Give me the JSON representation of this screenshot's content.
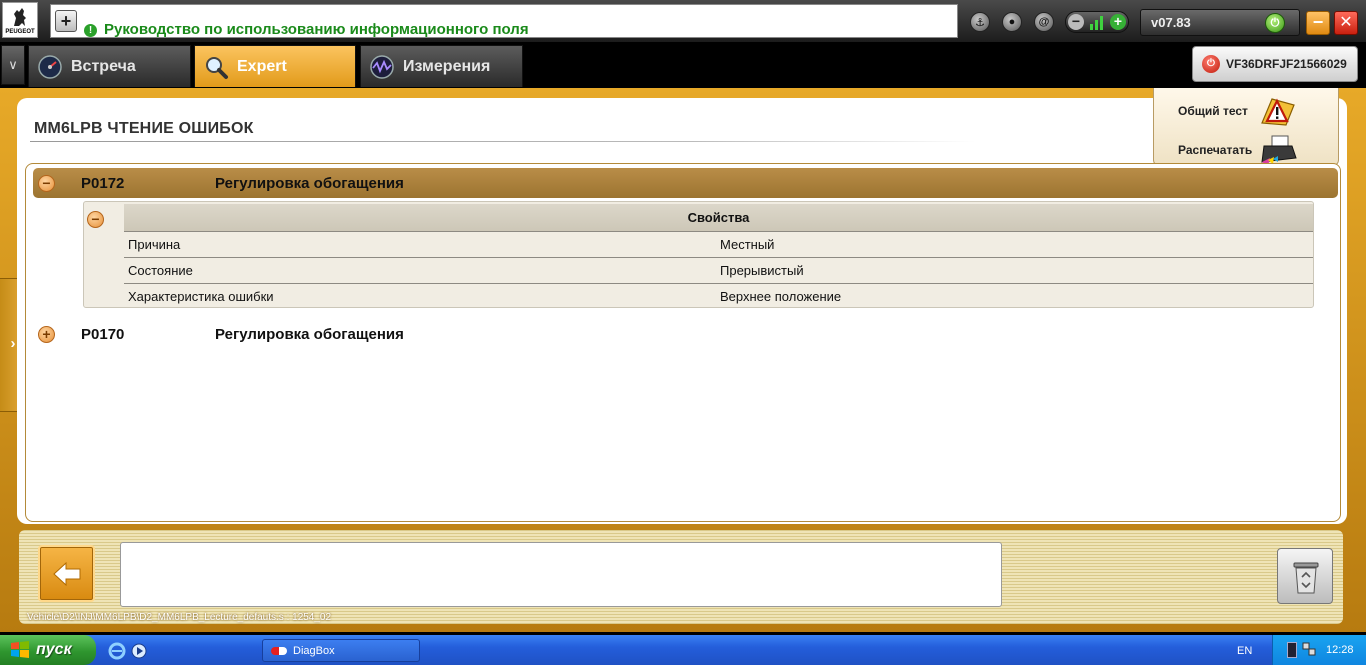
{
  "app": {
    "logo_text": "PEUGEOT",
    "info_text": "Руководство по использованию информационного поля",
    "version": "v07.83",
    "vin": "VF36DRFJF21566029"
  },
  "tabs": [
    {
      "label": "Встреча",
      "active": false
    },
    {
      "label": "Expert",
      "active": true
    },
    {
      "label": "Измерения",
      "active": false
    }
  ],
  "panel": {
    "title": "MM6LPB  ЧТЕНИЕ ОШИБОК",
    "actions": {
      "general_test": "Общий тест",
      "print": "Распечатать"
    }
  },
  "faults": [
    {
      "code": "P0172",
      "description": "Регулировка обогащения",
      "expanded": true,
      "properties_header": "Свойства",
      "properties": [
        {
          "key": "Причина",
          "value": "Местный"
        },
        {
          "key": "Состояние",
          "value": "Прерывистый"
        },
        {
          "key": "Характеристика ошибки",
          "value": "Верхнее положение"
        }
      ]
    },
    {
      "code": "P0170",
      "description": "Регулировка обогащения",
      "expanded": false
    }
  ],
  "status": {
    "path": "Vehicle\\D2\\INJ\\MM6LPB\\D2_MM6LPB_Lecture_defauts.s : 1254_02",
    "message": ""
  },
  "taskbar": {
    "start_label": "пуск",
    "task": "DiagBox",
    "language": "EN",
    "clock": "12:28"
  },
  "colors": {
    "accent_gold": "#e2a326",
    "fault_row": "#a8803a",
    "info_green": "#1a8a1a",
    "active_tab": "#f3b13c"
  },
  "icons": {
    "tab_meeting": "gauge-icon",
    "tab_expert": "magnifier-icon",
    "tab_measure": "waveform-icon",
    "general_test": "warning-icon",
    "print": "printer-icon",
    "back": "arrow-left-icon",
    "trash": "recycle-bin-icon"
  }
}
